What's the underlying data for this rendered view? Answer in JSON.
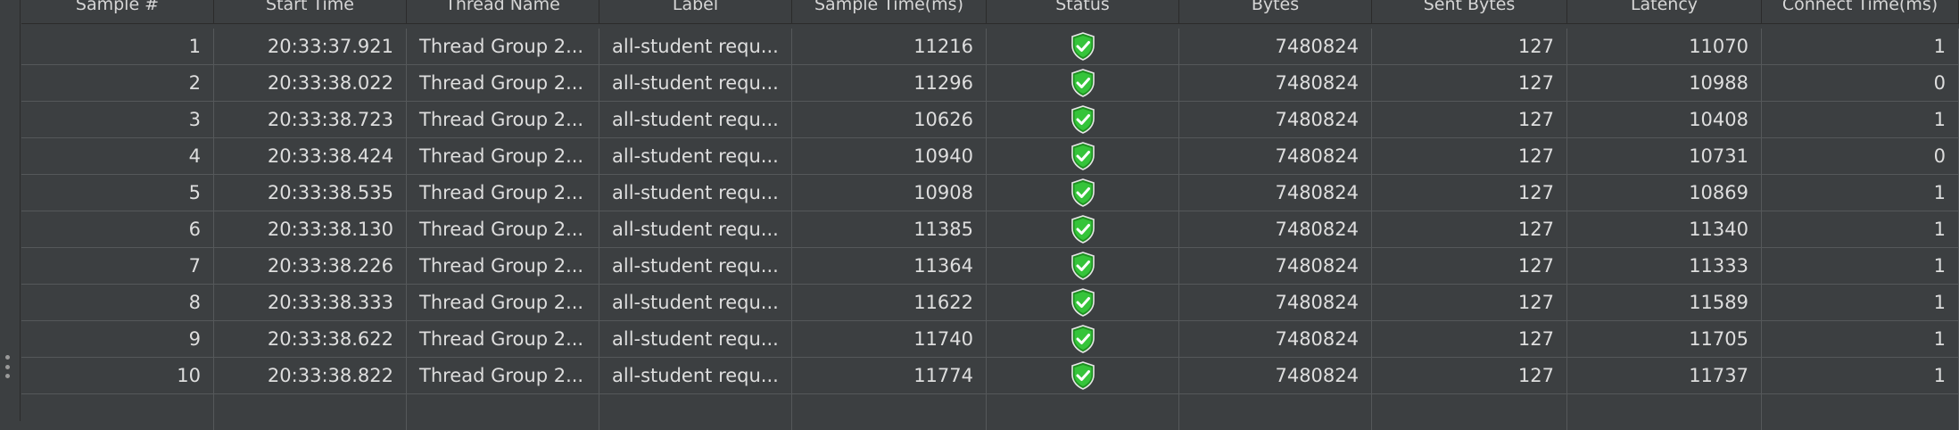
{
  "table": {
    "columns": [
      "Sample #",
      "Start Time",
      "Thread Name",
      "Label",
      "Sample Time(ms)",
      "Status",
      "Bytes",
      "Sent Bytes",
      "Latency",
      "Connect Time(ms)"
    ],
    "rows": [
      {
        "sample": "1",
        "start": "20:33:37.921",
        "thread": "Thread Group 2...",
        "label": "all-student requ...",
        "sample_time": "11216",
        "status_icon": "success-shield-icon",
        "bytes": "7480824",
        "sent": "127",
        "latency": "11070",
        "connect": "1"
      },
      {
        "sample": "2",
        "start": "20:33:38.022",
        "thread": "Thread Group 2...",
        "label": "all-student requ...",
        "sample_time": "11296",
        "status_icon": "success-shield-icon",
        "bytes": "7480824",
        "sent": "127",
        "latency": "10988",
        "connect": "0"
      },
      {
        "sample": "3",
        "start": "20:33:38.723",
        "thread": "Thread Group 2...",
        "label": "all-student requ...",
        "sample_time": "10626",
        "status_icon": "success-shield-icon",
        "bytes": "7480824",
        "sent": "127",
        "latency": "10408",
        "connect": "1"
      },
      {
        "sample": "4",
        "start": "20:33:38.424",
        "thread": "Thread Group 2...",
        "label": "all-student requ...",
        "sample_time": "10940",
        "status_icon": "success-shield-icon",
        "bytes": "7480824",
        "sent": "127",
        "latency": "10731",
        "connect": "0"
      },
      {
        "sample": "5",
        "start": "20:33:38.535",
        "thread": "Thread Group 2...",
        "label": "all-student requ...",
        "sample_time": "10908",
        "status_icon": "success-shield-icon",
        "bytes": "7480824",
        "sent": "127",
        "latency": "10869",
        "connect": "1"
      },
      {
        "sample": "6",
        "start": "20:33:38.130",
        "thread": "Thread Group 2...",
        "label": "all-student requ...",
        "sample_time": "11385",
        "status_icon": "success-shield-icon",
        "bytes": "7480824",
        "sent": "127",
        "latency": "11340",
        "connect": "1"
      },
      {
        "sample": "7",
        "start": "20:33:38.226",
        "thread": "Thread Group 2...",
        "label": "all-student requ...",
        "sample_time": "11364",
        "status_icon": "success-shield-icon",
        "bytes": "7480824",
        "sent": "127",
        "latency": "11333",
        "connect": "1"
      },
      {
        "sample": "8",
        "start": "20:33:38.333",
        "thread": "Thread Group 2...",
        "label": "all-student requ...",
        "sample_time": "11622",
        "status_icon": "success-shield-icon",
        "bytes": "7480824",
        "sent": "127",
        "latency": "11589",
        "connect": "1"
      },
      {
        "sample": "9",
        "start": "20:33:38.622",
        "thread": "Thread Group 2...",
        "label": "all-student requ...",
        "sample_time": "11740",
        "status_icon": "success-shield-icon",
        "bytes": "7480824",
        "sent": "127",
        "latency": "11705",
        "connect": "1"
      },
      {
        "sample": "10",
        "start": "20:33:38.822",
        "thread": "Thread Group 2...",
        "label": "all-student requ...",
        "sample_time": "11774",
        "status_icon": "success-shield-icon",
        "bytes": "7480824",
        "sent": "127",
        "latency": "11737",
        "connect": "1"
      }
    ]
  },
  "colors": {
    "background": "#3c3f41",
    "grid_line": "#55585a",
    "text": "#dedede",
    "status_success": "#2fb82f"
  }
}
